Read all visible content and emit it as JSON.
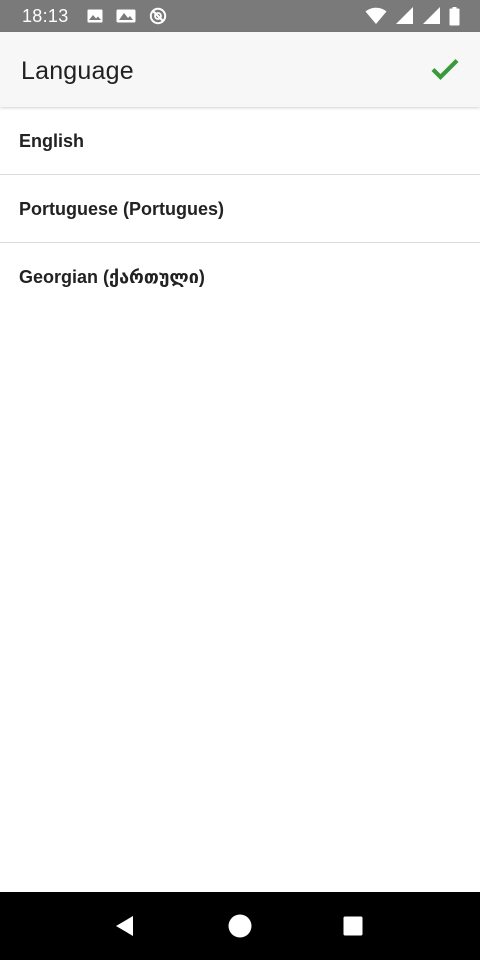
{
  "status_bar": {
    "time": "18:13",
    "left_icons": [
      "image-icon",
      "photo-icon",
      "no-disturb-icon"
    ],
    "right_icons": [
      "wifi-icon",
      "signal-icon",
      "signal-icon",
      "battery-icon"
    ]
  },
  "app_bar": {
    "title": "Language",
    "confirm_icon": "checkmark-icon",
    "accent_color": "#3a9a3a"
  },
  "languages": [
    {
      "label": "English"
    },
    {
      "label": "Portuguese (Portugues)"
    },
    {
      "label": "Georgian (ქართული)"
    }
  ],
  "nav_bar": {
    "buttons": [
      "back-icon",
      "home-icon",
      "recents-icon"
    ]
  }
}
